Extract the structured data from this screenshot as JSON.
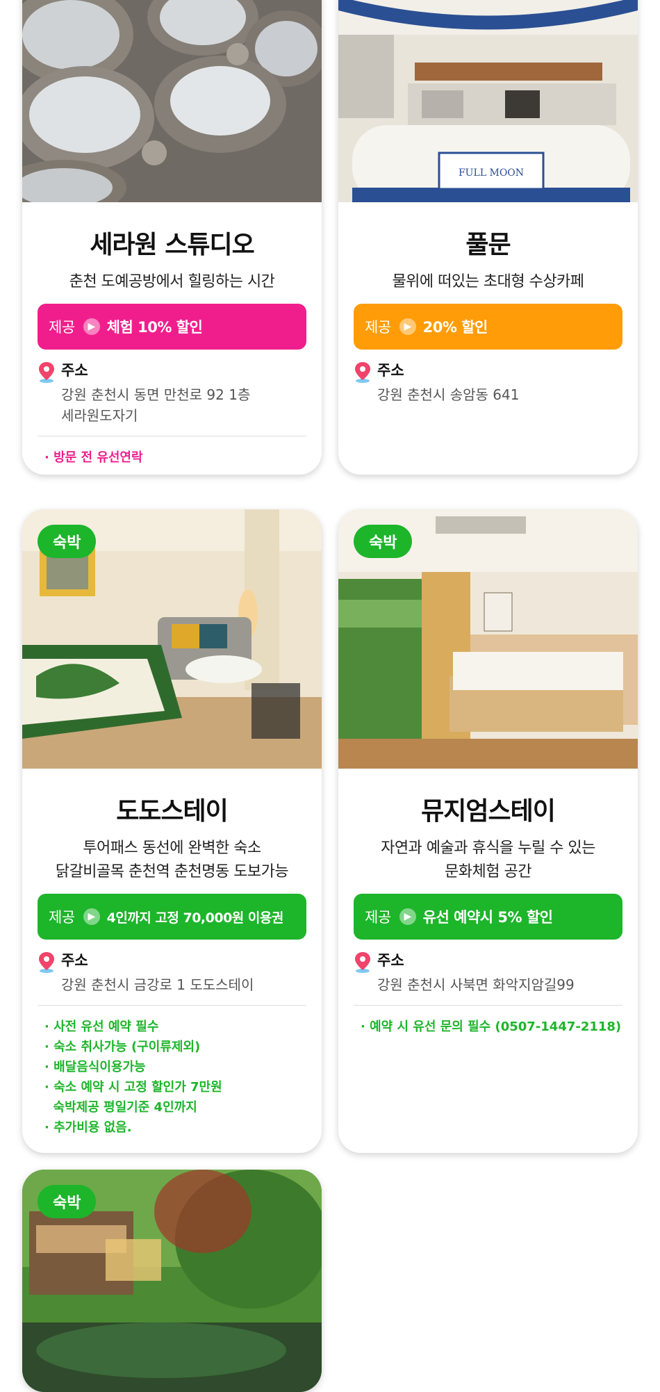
{
  "colors": {
    "pink": "#f01e8c",
    "orange": "#ff9c07",
    "green": "#1db52a"
  },
  "cards": [
    {
      "title": "세라원 스튜디오",
      "desc": [
        "춘천 도예공방에서 힐링하는 시간"
      ],
      "benefit_label": "제공",
      "benefit": "체험 10% 할인",
      "addr_head": "주소",
      "addr": [
        "강원 춘천시 동면 만천로 92 1층",
        "세라원도자기"
      ],
      "notes": [
        "· 방문 전 유선연락"
      ]
    },
    {
      "title": "풀문",
      "desc": [
        "물위에 떠있는 초대형 수상카페"
      ],
      "benefit_label": "제공",
      "benefit": "20% 할인",
      "addr_head": "주소",
      "addr": [
        "강원 춘천시 송암동 641"
      ],
      "sign": "FULL MOON"
    },
    {
      "tag": "숙박",
      "title": "도도스테이",
      "desc": [
        "투어패스 동선에 완벽한 숙소",
        "닭갈비골목 춘천역 춘천명동 도보가능"
      ],
      "benefit_label": "제공",
      "benefit": "4인까지 고정 70,000원 이용권",
      "addr_head": "주소",
      "addr": [
        "강원 춘천시 금강로 1 도도스테이"
      ],
      "notes": [
        "· 사전 유선 예약 필수",
        "· 숙소 취사가능 (구이류제외)",
        "· 배달음식이용가능",
        "· 숙소 예약 시 고정 할인가 7만원",
        "  숙박제공 평일기준 4인까지",
        "· 추가비용 없음."
      ]
    },
    {
      "tag": "숙박",
      "title": "뮤지엄스테이",
      "desc": [
        "자연과 예술과 휴식을 누릴 수 있는",
        "문화체험 공간"
      ],
      "benefit_label": "제공",
      "benefit": "유선 예약시 5% 할인",
      "addr_head": "주소",
      "addr": [
        "강원 춘천시 사북면 화악지암길99"
      ],
      "notes": [
        "· 예약 시 유선 문의 필수 (0507-1447-2118)"
      ]
    },
    {
      "tag": "숙박"
    }
  ]
}
